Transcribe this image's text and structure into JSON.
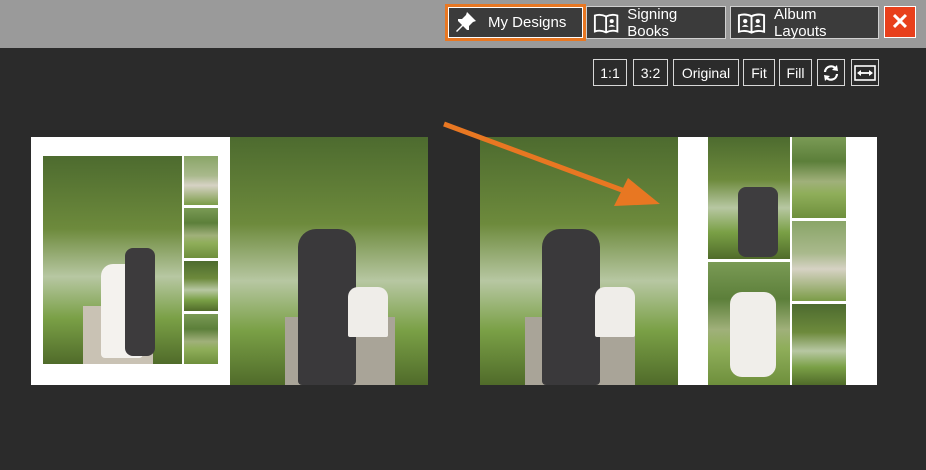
{
  "toolbar": {
    "my_designs": "My Designs",
    "signing_books": "Signing Books",
    "album_layouts": "Album Layouts",
    "close": "✕",
    "accent": "#e87722",
    "close_color": "#e8401c"
  },
  "ratio_buttons": {
    "one_one": "1:1",
    "three_two": "3:2",
    "original": "Original",
    "fit": "Fit",
    "fill": "Fill"
  }
}
